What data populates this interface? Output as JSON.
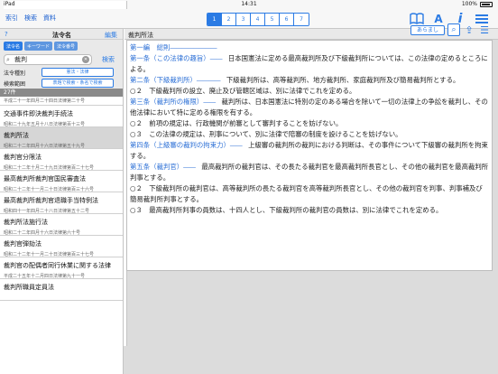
{
  "status": {
    "device": "iPad",
    "time": "14:31",
    "battery": "100%"
  },
  "toolbar": {
    "links": [
      "索引",
      "検索",
      "資料"
    ],
    "segments": [
      "1",
      "2",
      "3",
      "4",
      "5",
      "6",
      "7"
    ],
    "active_segment": 0,
    "icons": [
      "book-icon",
      "font-size-icon",
      "help-icon",
      "menu-icon"
    ]
  },
  "left": {
    "help": "?",
    "title": "法令名",
    "edit": "編集",
    "tabs": [
      "法令名",
      "キーワード",
      "法令番号"
    ],
    "search": {
      "value": "裁判",
      "placeholder": "",
      "go": "検索"
    },
    "filter1": {
      "label": "法令種別",
      "button": "憲法・法律"
    },
    "filter2": {
      "label": "検索範囲",
      "button": "表題で検索・条名で検索"
    },
    "count": "27件",
    "first_sub": "平成二十一年四月二十四日法律第二十号",
    "items": [
      {
        "name": "交通事件即決裁判手続法",
        "sub": "昭和二十九年五月十八日法律第百十三号"
      },
      {
        "name": "裁判所法",
        "sub": "昭和二十二年四月十六日法律第五十九号"
      },
      {
        "name": "裁判官分限法",
        "sub": "昭和二十二年十月二十九日法律第百二十七号"
      },
      {
        "name": "最高裁判所裁判官国民審査法",
        "sub": "昭和二十二年十一月二十日法律第百三十六号"
      },
      {
        "name": "最高裁判所裁判官退職手当特例法",
        "sub": "昭和四十一年四月二十八日法律第五十二号"
      },
      {
        "name": "裁判所法施行法",
        "sub": "昭和二十二年四月十六日法律第六十号"
      },
      {
        "name": "裁判官弾劾法",
        "sub": "昭和二十二年十一月二十日法律第百三十七号"
      },
      {
        "name": "裁判官の配偶者同行休業に関する法律",
        "sub": "平成二十五年十二月四日法律第九十一号"
      },
      {
        "name": "裁判所職員定員法",
        "sub": ""
      }
    ],
    "selected_index": 1
  },
  "right": {
    "title": "裁判所法",
    "summary_button": "あらまし",
    "paragraphs": [
      {
        "head": "第一編　総則",
        "text": ""
      },
      {
        "head": "第一条（この法律の趣旨）",
        "text": "日本国憲法に定める最高裁判所及び下級裁判所については、この法律の定めるところによる。"
      },
      {
        "head": "第二条（下級裁判所）",
        "text": "下級裁判所は、高等裁判所、地方裁判所、家庭裁判所及び簡易裁判所とする。"
      },
      {
        "head": "○２",
        "text": "下級裁判所の設立、廃止及び管轄区域は、別に法律でこれを定める。"
      },
      {
        "head": "第三条（裁判所の権限）",
        "text": "裁判所は、日本国憲法に特別の定のある場合を除いて一切の法律上の争訟を裁判し、その他法律において特に定める権限を有する。"
      },
      {
        "head": "○２",
        "text": "前項の規定は、行政機関が前審として審判することを妨げない。"
      },
      {
        "head": "○３",
        "text": "この法律の規定は、刑事について、別に法律で陪審の制度を設けることを妨げない。"
      },
      {
        "head": "第四条（上級審の裁判の拘束力）",
        "text": "上級審の裁判所の裁判における判断は、その事件について下級審の裁判所を拘束する。"
      },
      {
        "head": "第五条（裁判官）",
        "text": "最高裁判所の裁判官は、その長たる裁判官を最高裁判所長官とし、その他の裁判官を最高裁判所判事とする。"
      },
      {
        "head": "○２",
        "text": "下級裁判所の裁判官は、高等裁判所の長たる裁判官を高等裁判所長官とし、その他の裁判官を判事、判事補及び簡易裁判所判事とする。"
      },
      {
        "head": "○３",
        "text": "最高裁判所判事の員数は、十四人とし、下級裁判所の裁判官の員数は、別に法律でこれを定める。"
      }
    ]
  }
}
